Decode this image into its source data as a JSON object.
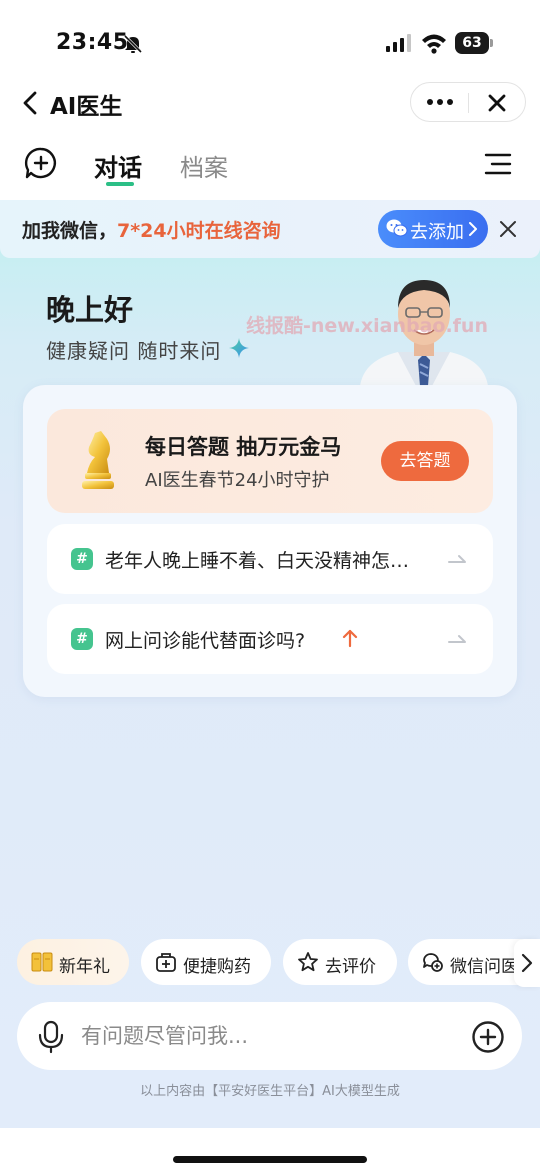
{
  "status_bar": {
    "time": "23:45",
    "battery": "63"
  },
  "nav": {
    "title": "AI医生"
  },
  "tabs": [
    {
      "label": "对话",
      "active": true
    },
    {
      "label": "档案",
      "active": false
    }
  ],
  "banner": {
    "text_prefix": "加我微信，",
    "text_highlight": "7*24小时在线咨询",
    "button_label": "去添加"
  },
  "greeting": {
    "title": "晚上好",
    "subtitle": "健康疑问 随时来问",
    "watermark": "线报酷-new.xianbao.fun"
  },
  "quiz": {
    "title": "每日答题 抽万元金马",
    "subtitle": "AI医生春节24小时守护",
    "button_label": "去答题"
  },
  "questions": [
    {
      "text": "老年人晚上睡不着、白天没精神怎…",
      "hot": false
    },
    {
      "text": "网上问诊能代替面诊吗?",
      "hot": true
    }
  ],
  "chips": [
    {
      "label": "新年礼",
      "icon": "gold-bar-icon"
    },
    {
      "label": "便捷购药",
      "icon": "medicine-bag-icon"
    },
    {
      "label": "去评价",
      "icon": "star-icon"
    },
    {
      "label": "微信问医",
      "icon": "wechat-consult-icon"
    }
  ],
  "input": {
    "placeholder": "有问题尽管问我...",
    "value": ""
  },
  "disclaimer": "以上内容由【平安好医生平台】AI大模型生成",
  "colors": {
    "accent_green": "#2bbf86",
    "accent_orange": "#ee6a3e",
    "highlight_orange": "#e8643c",
    "button_blue": "#3a6ef0"
  }
}
